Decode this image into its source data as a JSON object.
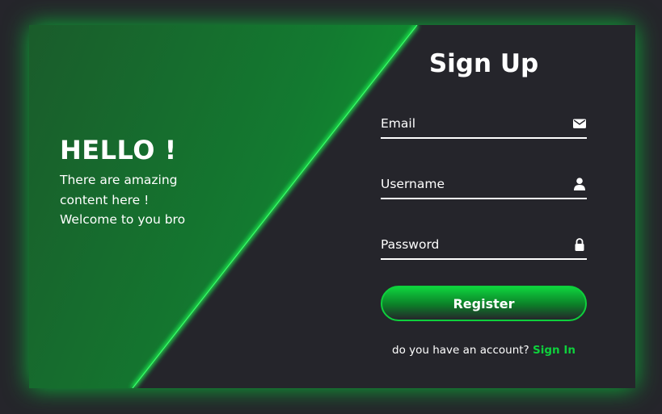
{
  "left_panel": {
    "heading": "HELLO !",
    "lines": [
      "There are amazing",
      "content here !",
      "Welcome to you bro"
    ]
  },
  "form": {
    "title": "Sign Up",
    "email": {
      "placeholder": "Email",
      "value": "",
      "icon": "envelope-icon"
    },
    "username": {
      "placeholder": "Username",
      "value": "",
      "icon": "user-icon"
    },
    "password": {
      "placeholder": "Password",
      "value": "",
      "icon": "lock-icon"
    },
    "submit_label": "Register",
    "account_prompt": "do you have an account?",
    "signin_label": "Sign In"
  },
  "colors": {
    "background": "#25252b",
    "accent": "#0ed03c",
    "text": "#ffffff"
  }
}
